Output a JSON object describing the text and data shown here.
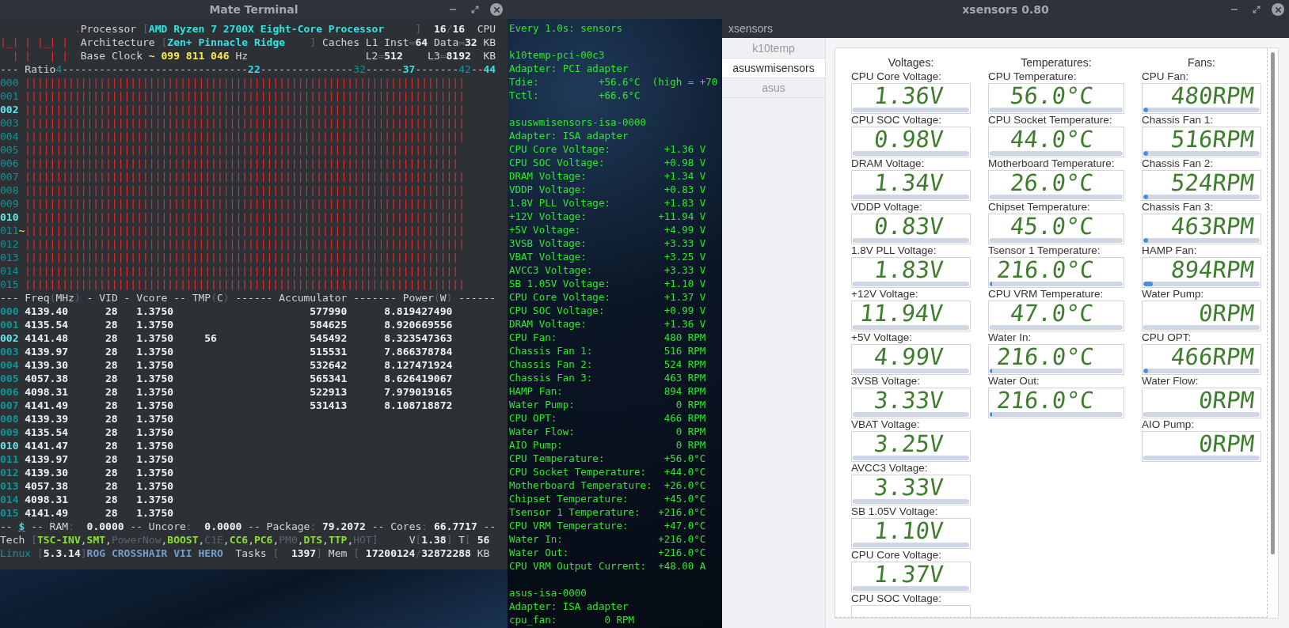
{
  "terminal": {
    "title": "Mate Terminal",
    "header_lines": [
      [
        {
          "text": "            .",
          "kind": "red"
        },
        {
          "text": "Processor ",
          "kind": "plain"
        },
        {
          "text": "[",
          "kind": "dim"
        },
        {
          "text": "AMD Ryzen 7 2700X Eight-Core Processor",
          "kind": "cyan"
        },
        {
          "text": "     ]",
          "kind": "dim"
        },
        {
          "text": "  16",
          "kind": "white"
        },
        {
          "text": "/",
          "kind": "dim"
        },
        {
          "text": "16",
          "kind": "white"
        },
        {
          "text": "  CPU",
          "kind": "plain"
        }
      ],
      [
        {
          "text": "|_| | |_| |",
          "kind": "red"
        },
        {
          "text": "  Architecture ",
          "kind": "plain"
        },
        {
          "text": "[",
          "kind": "dim"
        },
        {
          "text": "Zen+ Pinnacle Ridge",
          "kind": "cyan"
        },
        {
          "text": "    ]",
          "kind": "dim"
        },
        {
          "text": " Caches L1 Inst",
          "kind": "plain"
        },
        {
          "text": "=",
          "kind": "dim"
        },
        {
          "text": "64",
          "kind": "white"
        },
        {
          "text": " Data",
          "kind": "plain"
        },
        {
          "text": "=",
          "kind": "dim"
        },
        {
          "text": "32",
          "kind": "white"
        },
        {
          "text": " KB",
          "kind": "plain"
        }
      ],
      [
        {
          "text": "  | |   | |",
          "kind": "red"
        },
        {
          "text": "  Base Clock ",
          "kind": "plain"
        },
        {
          "text": "~ 099 811 046",
          "kind": "yellow"
        },
        {
          "text": " Hz                   L2",
          "kind": "plain"
        },
        {
          "text": "=",
          "kind": "dim"
        },
        {
          "text": "512",
          "kind": "white"
        },
        {
          "text": "    L3",
          "kind": "plain"
        },
        {
          "text": "=",
          "kind": "dim"
        },
        {
          "text": "8192",
          "kind": "white"
        },
        {
          "text": "  KB",
          "kind": "plain"
        }
      ],
      [
        {
          "text": "--- Ratio",
          "kind": "plain"
        },
        {
          "text": "4",
          "kind": "teal"
        },
        {
          "text": "------------------------------",
          "kind": "plain"
        },
        {
          "text": "22",
          "kind": "cyan"
        },
        {
          "text": "---------------",
          "kind": "plain"
        },
        {
          "text": "32",
          "kind": "teal"
        },
        {
          "text": "------",
          "kind": "plain"
        },
        {
          "text": "37",
          "kind": "cyan"
        },
        {
          "text": "-------",
          "kind": "plain"
        },
        {
          "text": "42",
          "kind": "teal"
        },
        {
          "text": "--",
          "kind": "plain"
        },
        {
          "text": "44",
          "kind": "cyan"
        }
      ]
    ],
    "bar_rows": [
      {
        "cpu": "000",
        "highlight": false,
        "bars": "|||||||||||||||||||||||||||||||||||||||||||||||||||||||||||||||||||||||"
      },
      {
        "cpu": "001",
        "highlight": false,
        "bars": "|||||||||||||||||||||||||||||||||||||||||||||||||||||||||||||||||||||||"
      },
      {
        "cpu": "002",
        "highlight": true,
        "bars": "|||||||||||||||||||||||||||||||||||||||||||||||||||||||||||||||||||||||"
      },
      {
        "cpu": "003",
        "highlight": false,
        "bars": "|||||||||||||||||||||||||||||||||||||||||||||||||||||||||||||||||||||||"
      },
      {
        "cpu": "004",
        "highlight": false,
        "bars": "|||||||||||||||||||||||||||||||||||||||||||||||||||||||||||||||||||||||"
      },
      {
        "cpu": "005",
        "highlight": false,
        "bars": "||||||||||||||||||||||||||||||||||||||||||||||||||||||||||||||||||||||"
      },
      {
        "cpu": "006",
        "highlight": false,
        "bars": "||||||||||||||||||||||||||||||||||||||||||||||||||||||||||||||||||||||"
      },
      {
        "cpu": "007",
        "highlight": false,
        "bars": "|||||||||||||||||||||||||||||||||||||||||||||||||||||||||||||||||||||||"
      },
      {
        "cpu": "008",
        "highlight": false,
        "bars": "|||||||||||||||||||||||||||||||||||||||||||||||||||||||||||||||||||||||"
      },
      {
        "cpu": "009",
        "highlight": false,
        "bars": "|||||||||||||||||||||||||||||||||||||||||||||||||||||||||||||||||||||||"
      },
      {
        "cpu": "010",
        "highlight": true,
        "bars": "|||||||||||||||||||||||||||||||||||||||||||||||||||||||||||||||||||||||"
      },
      {
        "cpu": "011",
        "highlight": false,
        "marker": "~",
        "bars": "|||||||||||||||||||||||||||||||||||||||||||||||||||||||||||||||||||||||"
      },
      {
        "cpu": "012",
        "highlight": false,
        "bars": "|||||||||||||||||||||||||||||||||||||||||||||||||||||||||||||||||||||||"
      },
      {
        "cpu": "013",
        "highlight": false,
        "bars": "||||||||||||||||||||||||||||||||||||||||||||||||||||||||||||||||||||||"
      },
      {
        "cpu": "014",
        "highlight": false,
        "bars": "||||||||||||||||||||||||||||||||||||||||||||||||||||||||||||||||||||||"
      },
      {
        "cpu": "015",
        "highlight": false,
        "bars": "|||||||||||||||||||||||||||||||||||||||||||||||||||||||||||||||||||||||"
      }
    ],
    "column_header": [
      {
        "text": "--- Freq",
        "kind": "plain"
      },
      {
        "text": "(",
        "kind": "dim"
      },
      {
        "text": "MHz",
        "kind": "plain"
      },
      {
        "text": ")",
        "kind": "dim"
      },
      {
        "text": " - VID - Vcore -- TMP",
        "kind": "plain"
      },
      {
        "text": "(",
        "kind": "dim"
      },
      {
        "text": "C",
        "kind": "plain"
      },
      {
        "text": ")",
        "kind": "dim"
      },
      {
        "text": " ------ Accumulator ------- Power",
        "kind": "plain"
      },
      {
        "text": "(",
        "kind": "dim"
      },
      {
        "text": "W",
        "kind": "plain"
      },
      {
        "text": ")",
        "kind": "dim"
      },
      {
        "text": " ------",
        "kind": "plain"
      }
    ],
    "rows": [
      {
        "cpu": "000",
        "highlight": false,
        "freq": "4139.40",
        "vid": "28",
        "vcore": "1.3750",
        "accumulator": "577990",
        "power": "8.819427490"
      },
      {
        "cpu": "001",
        "highlight": false,
        "freq": "4135.54",
        "vid": "28",
        "vcore": "1.3750",
        "accumulator": "584625",
        "power": "8.920669556"
      },
      {
        "cpu": "002",
        "highlight": true,
        "freq": "4141.48",
        "vid": "28",
        "vcore": "1.3750",
        "tmp": "56",
        "accumulator": "545492",
        "power": "8.323547363"
      },
      {
        "cpu": "003",
        "highlight": false,
        "freq": "4139.97",
        "vid": "28",
        "vcore": "1.3750",
        "accumulator": "515531",
        "power": "7.866378784"
      },
      {
        "cpu": "004",
        "highlight": false,
        "freq": "4139.30",
        "vid": "28",
        "vcore": "1.3750",
        "accumulator": "532642",
        "power": "8.127471924"
      },
      {
        "cpu": "005",
        "highlight": false,
        "freq": "4057.38",
        "vid": "28",
        "vcore": "1.3750",
        "accumulator": "565341",
        "power": "8.626419067"
      },
      {
        "cpu": "006",
        "highlight": false,
        "freq": "4098.31",
        "vid": "28",
        "vcore": "1.3750",
        "accumulator": "522913",
        "power": "7.979019165"
      },
      {
        "cpu": "007",
        "highlight": false,
        "freq": "4141.49",
        "vid": "28",
        "vcore": "1.3750",
        "accumulator": "531413",
        "power": "8.108718872"
      },
      {
        "cpu": "008",
        "highlight": false,
        "freq": "4139.39",
        "vid": "28",
        "vcore": "1.3750"
      },
      {
        "cpu": "009",
        "highlight": false,
        "freq": "4135.54",
        "vid": "28",
        "vcore": "1.3750"
      },
      {
        "cpu": "010",
        "highlight": true,
        "freq": "4141.47",
        "vid": "28",
        "vcore": "1.3750"
      },
      {
        "cpu": "011",
        "highlight": false,
        "freq": "4139.97",
        "vid": "28",
        "vcore": "1.3750"
      },
      {
        "cpu": "012",
        "highlight": false,
        "freq": "4139.30",
        "vid": "28",
        "vcore": "1.3750"
      },
      {
        "cpu": "013",
        "highlight": false,
        "freq": "4057.38",
        "vid": "28",
        "vcore": "1.3750"
      },
      {
        "cpu": "014",
        "highlight": false,
        "freq": "4098.31",
        "vid": "28",
        "vcore": "1.3750"
      },
      {
        "cpu": "015",
        "highlight": false,
        "freq": "4141.49",
        "vid": "28",
        "vcore": "1.3750"
      }
    ],
    "footer_lines": [
      [
        {
          "text": "-- ",
          "kind": "plain"
        },
        {
          "text": "$",
          "kind": "link"
        },
        {
          "text": " -- RAM",
          "kind": "plain"
        },
        {
          "text": ":",
          "kind": "dim"
        },
        {
          "text": "  0.0000",
          "kind": "white"
        },
        {
          "text": " -- Uncore",
          "kind": "plain"
        },
        {
          "text": ":",
          "kind": "dim"
        },
        {
          "text": "  0.0000",
          "kind": "white"
        },
        {
          "text": " -- Package",
          "kind": "plain"
        },
        {
          "text": ":",
          "kind": "dim"
        },
        {
          "text": " 79.2072",
          "kind": "white"
        },
        {
          "text": " -- Cores",
          "kind": "plain"
        },
        {
          "text": ":",
          "kind": "dim"
        },
        {
          "text": " 66.7717",
          "kind": "white"
        },
        {
          "text": " --",
          "kind": "plain"
        }
      ],
      [
        {
          "text": "Tech ",
          "kind": "plain"
        },
        {
          "text": "[",
          "kind": "dim"
        },
        {
          "text": "TSC-INV",
          "kind": "green"
        },
        {
          "text": ",",
          "kind": "plain"
        },
        {
          "text": "SMT",
          "kind": "green"
        },
        {
          "text": ",",
          "kind": "plain"
        },
        {
          "text": "PowerNow",
          "kind": "off"
        },
        {
          "text": ",",
          "kind": "plain"
        },
        {
          "text": "BOOST",
          "kind": "green"
        },
        {
          "text": ",",
          "kind": "plain"
        },
        {
          "text": "C1E",
          "kind": "off"
        },
        {
          "text": ",",
          "kind": "plain"
        },
        {
          "text": "CC6",
          "kind": "green"
        },
        {
          "text": ",",
          "kind": "plain"
        },
        {
          "text": "PC6",
          "kind": "green"
        },
        {
          "text": ",",
          "kind": "plain"
        },
        {
          "text": "PM0",
          "kind": "off"
        },
        {
          "text": ",",
          "kind": "plain"
        },
        {
          "text": "DTS",
          "kind": "green"
        },
        {
          "text": ",",
          "kind": "plain"
        },
        {
          "text": "TTP",
          "kind": "green"
        },
        {
          "text": ",",
          "kind": "plain"
        },
        {
          "text": "HOT",
          "kind": "off"
        },
        {
          "text": "]",
          "kind": "dim"
        },
        {
          "text": "     V",
          "kind": "plain"
        },
        {
          "text": "[",
          "kind": "dim"
        },
        {
          "text": "1.38",
          "kind": "white"
        },
        {
          "text": "]",
          "kind": "dim"
        },
        {
          "text": " T",
          "kind": "plain"
        },
        {
          "text": "[",
          "kind": "dim"
        },
        {
          "text": " 56",
          "kind": "white"
        }
      ],
      [
        {
          "text": "Linux ",
          "kind": "teal"
        },
        {
          "text": "[",
          "kind": "dim"
        },
        {
          "text": "5.3.14",
          "kind": "white"
        },
        {
          "text": "]",
          "kind": "dim"
        },
        {
          "text": "ROG CROSSHAIR VII HERO",
          "kind": "blue"
        },
        {
          "text": "  Tasks ",
          "kind": "plain"
        },
        {
          "text": "[",
          "kind": "dim"
        },
        {
          "text": "  1397",
          "kind": "white"
        },
        {
          "text": "]",
          "kind": "dim"
        },
        {
          "text": " Mem ",
          "kind": "plain"
        },
        {
          "text": "[",
          "kind": "dim"
        },
        {
          "text": " 17200124",
          "kind": "white"
        },
        {
          "text": "/",
          "kind": "dim"
        },
        {
          "text": "32872288",
          "kind": "white"
        },
        {
          "text": " KB",
          "kind": "plain"
        }
      ]
    ]
  },
  "sensors_terminal": {
    "sections": [
      {
        "lines": [
          {
            "kind": "text",
            "text": "Every 1.0s: sensors"
          }
        ]
      },
      {
        "lines": [
          {
            "kind": "text",
            "text": "k10temp-pci-00c3"
          },
          {
            "kind": "text",
            "text": "Adapter: PCI adapter"
          },
          {
            "kind": "text",
            "text": "Tdie:          +56.6°C  (high = +70"
          },
          {
            "kind": "text",
            "text": "Tctl:          +66.6°C"
          }
        ]
      },
      {
        "lines": [
          {
            "kind": "text",
            "text": "asuswmisensors-isa-0000"
          },
          {
            "kind": "text",
            "text": "Adapter: ISA adapter"
          },
          {
            "kind": "reading",
            "label": "CPU Core Voltage:",
            "value": "+1.36 V"
          },
          {
            "kind": "reading",
            "label": "CPU SOC Voltage:",
            "value": "+0.98 V"
          },
          {
            "kind": "reading",
            "label": "DRAM Voltage:",
            "value": "+1.34 V"
          },
          {
            "kind": "reading",
            "label": "VDDP Voltage:",
            "value": "+0.83 V"
          },
          {
            "kind": "reading",
            "label": "1.8V PLL Voltage:",
            "value": "+1.83 V"
          },
          {
            "kind": "reading",
            "label": "+12V Voltage:",
            "value": "+11.94 V"
          },
          {
            "kind": "reading",
            "label": "+5V Voltage:",
            "value": "+4.99 V"
          },
          {
            "kind": "reading",
            "label": "3VSB Voltage:",
            "value": "+3.33 V"
          },
          {
            "kind": "reading",
            "label": "VBAT Voltage:",
            "value": "+3.25 V"
          },
          {
            "kind": "reading",
            "label": "AVCC3 Voltage:",
            "value": "+3.33 V"
          },
          {
            "kind": "reading",
            "label": "SB 1.05V Voltage:",
            "value": "+1.10 V"
          },
          {
            "kind": "reading",
            "label": "CPU Core Voltage:",
            "value": "+1.37 V"
          },
          {
            "kind": "reading",
            "label": "CPU SOC Voltage:",
            "value": "+0.99 V"
          },
          {
            "kind": "reading",
            "label": "DRAM Voltage:",
            "value": "+1.36 V"
          },
          {
            "kind": "reading",
            "label": "CPU Fan:",
            "value": "480 RPM"
          },
          {
            "kind": "reading",
            "label": "Chassis Fan 1:",
            "value": "516 RPM"
          },
          {
            "kind": "reading",
            "label": "Chassis Fan 2:",
            "value": "524 RPM"
          },
          {
            "kind": "reading",
            "label": "Chassis Fan 3:",
            "value": "463 RPM"
          },
          {
            "kind": "reading",
            "label": "HAMP Fan:",
            "value": "894 RPM"
          },
          {
            "kind": "reading",
            "label": "Water Pump:",
            "value": "0 RPM"
          },
          {
            "kind": "reading",
            "label": "CPU OPT:",
            "value": "466 RPM"
          },
          {
            "kind": "reading",
            "label": "Water Flow:",
            "value": "0 RPM"
          },
          {
            "kind": "reading",
            "label": "AIO Pump:",
            "value": "0 RPM"
          },
          {
            "kind": "reading",
            "label": "CPU Temperature:",
            "value": "+56.0°C"
          },
          {
            "kind": "reading",
            "label": "CPU Socket Temperature:",
            "value": "+44.0°C"
          },
          {
            "kind": "reading",
            "label": "Motherboard Temperature:",
            "value": "+26.0°C"
          },
          {
            "kind": "reading",
            "label": "Chipset Temperature:",
            "value": "+45.0°C"
          },
          {
            "kind": "reading",
            "label": "Tsensor 1 Temperature:",
            "value": "+216.0°C"
          },
          {
            "kind": "reading",
            "label": "CPU VRM Temperature:",
            "value": "+47.0°C"
          },
          {
            "kind": "reading",
            "label": "Water In:",
            "value": "+216.0°C"
          },
          {
            "kind": "reading",
            "label": "Water Out:",
            "value": "+216.0°C"
          },
          {
            "kind": "reading",
            "label": "CPU VRM Output Current:",
            "value": "+48.00 A"
          }
        ]
      },
      {
        "lines": [
          {
            "kind": "text",
            "text": "asus-isa-0000"
          },
          {
            "kind": "text",
            "text": "Adapter: ISA adapter"
          },
          {
            "kind": "text",
            "text": "cpu_fan:        0 RPM"
          }
        ]
      }
    ]
  },
  "xsensors": {
    "title": "xsensors 0.80",
    "menu": "xsensors",
    "tabs": [
      {
        "label": "k10temp",
        "selected": false
      },
      {
        "label": "asuswmisensors",
        "selected": true
      },
      {
        "label": "asus",
        "selected": false
      }
    ],
    "columns": [
      {
        "heading": "Voltages:",
        "sensors": [
          {
            "label": "CPU Core Voltage:",
            "value": "1.36V",
            "level": 0
          },
          {
            "label": "CPU SOC Voltage:",
            "value": "0.98V",
            "level": 0
          },
          {
            "label": "DRAM Voltage:",
            "value": "1.34V",
            "level": 0
          },
          {
            "label": "VDDP Voltage:",
            "value": "0.83V",
            "level": 0
          },
          {
            "label": "1.8V PLL Voltage:",
            "value": "1.83V",
            "level": 0
          },
          {
            "label": "+12V Voltage:",
            "value": "11.94V",
            "level": 0
          },
          {
            "label": "+5V Voltage:",
            "value": "4.99V",
            "level": 0
          },
          {
            "label": "3VSB Voltage:",
            "value": "3.33V",
            "level": 0
          },
          {
            "label": "VBAT Voltage:",
            "value": "3.25V",
            "level": 0
          },
          {
            "label": "AVCC3 Voltage:",
            "value": "3.33V",
            "level": 0
          },
          {
            "label": "SB 1.05V Voltage:",
            "value": "1.10V",
            "level": 0
          },
          {
            "label": "CPU Core Voltage:",
            "value": "1.37V",
            "level": 0
          },
          {
            "label": "CPU SOC Voltage:"
          }
        ]
      },
      {
        "heading": "Temperatures:",
        "sensors": [
          {
            "label": "CPU Temperature:",
            "value": "56.0°C",
            "level": 0
          },
          {
            "label": "CPU Socket Temperature:",
            "value": "44.0°C",
            "level": 0
          },
          {
            "label": "Motherboard Temperature:",
            "value": "26.0°C",
            "level": 0
          },
          {
            "label": "Chipset Temperature:",
            "value": "45.0°C",
            "level": 0
          },
          {
            "label": "Tsensor 1 Temperature:",
            "value": "216.0°C",
            "level": 0.02
          },
          {
            "label": "CPU VRM Temperature:",
            "value": "47.0°C",
            "level": 0
          },
          {
            "label": "Water In:",
            "value": "216.0°C",
            "level": 0.02
          },
          {
            "label": "Water Out:",
            "value": "216.0°C",
            "level": 0.02
          }
        ]
      },
      {
        "heading": "Fans:",
        "sensors": [
          {
            "label": "CPU Fan:",
            "value": "480RPM",
            "level": 0.04
          },
          {
            "label": "Chassis Fan 1:",
            "value": "516RPM",
            "level": 0.04
          },
          {
            "label": "Chassis Fan 2:",
            "value": "524RPM",
            "level": 0.04
          },
          {
            "label": "Chassis Fan 3:",
            "value": "463RPM",
            "level": 0.04
          },
          {
            "label": "HAMP Fan:",
            "value": "894RPM",
            "level": 0.08
          },
          {
            "label": "Water Pump:",
            "value": "0RPM",
            "level": 0
          },
          {
            "label": "CPU OPT:",
            "value": "466RPM",
            "level": 0.04
          },
          {
            "label": "Water Flow:",
            "value": "0RPM",
            "level": 0
          },
          {
            "label": "AIO Pump:",
            "value": "0RPM",
            "level": 0
          }
        ]
      }
    ]
  }
}
